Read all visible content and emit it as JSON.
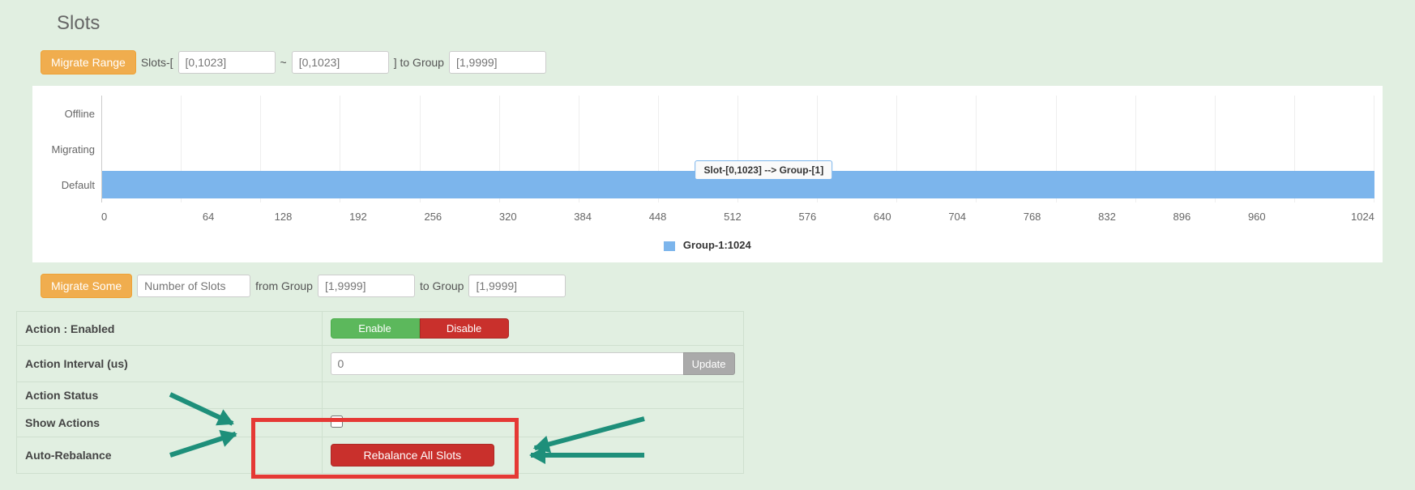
{
  "title": "Slots",
  "migrate_range": {
    "button": "Migrate Range",
    "prefix": "Slots-[",
    "from_placeholder": "[0,1023]",
    "tilde": "~",
    "to_placeholder": "[0,1023]",
    "suffix": "] to Group",
    "group_placeholder": "[1,9999]"
  },
  "chart_data": {
    "type": "bar",
    "categories": [
      "Offline",
      "Migrating",
      "Default"
    ],
    "x_ticks": [
      "0",
      "64",
      "128",
      "192",
      "256",
      "320",
      "384",
      "448",
      "512",
      "576",
      "640",
      "704",
      "768",
      "832",
      "896",
      "960",
      "1024"
    ],
    "series": [
      {
        "name": "Group-1:1024",
        "category": "Default",
        "from": 0,
        "to": 1023,
        "color": "#7cb5ec"
      }
    ],
    "xlim": [
      0,
      1024
    ],
    "tooltip": "Slot-[0,1023] --> Group-[1]",
    "legend": "Group-1:1024"
  },
  "migrate_some": {
    "button": "Migrate Some",
    "slots_placeholder": "Number of Slots",
    "from_label": "from Group",
    "from_placeholder": "[1,9999]",
    "to_label": "to Group",
    "to_placeholder": "[1,9999]"
  },
  "config": {
    "action_label": "Action : Enabled",
    "enable": "Enable",
    "disable": "Disable",
    "interval_label": "Action Interval (us)",
    "interval_value": "0",
    "update": "Update",
    "status_label": "Action Status",
    "show_actions_label": "Show Actions",
    "auto_rebalance_label": "Auto-Rebalance",
    "rebalance_button": "Rebalance All Slots"
  }
}
